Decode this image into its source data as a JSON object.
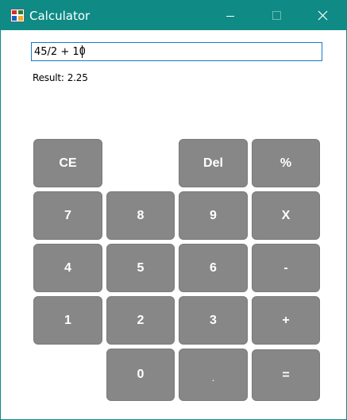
{
  "window": {
    "title": "Calculator",
    "colors": {
      "titlebar": "#0f8a85",
      "button": "#878787",
      "button_text": "#ffffff",
      "input_border": "#1979ca"
    }
  },
  "input": {
    "value": "45/2 + 10"
  },
  "result": {
    "label": "Result:",
    "value": "2.25"
  },
  "keys": {
    "ce": "CE",
    "del": "Del",
    "percent": "%",
    "seven": "7",
    "eight": "8",
    "nine": "9",
    "multiply": "X",
    "four": "4",
    "five": "5",
    "six": "6",
    "subtract": "-",
    "one": "1",
    "two": "2",
    "three": "3",
    "add": "+",
    "zero": "0",
    "decimal": ".",
    "equals": "="
  }
}
